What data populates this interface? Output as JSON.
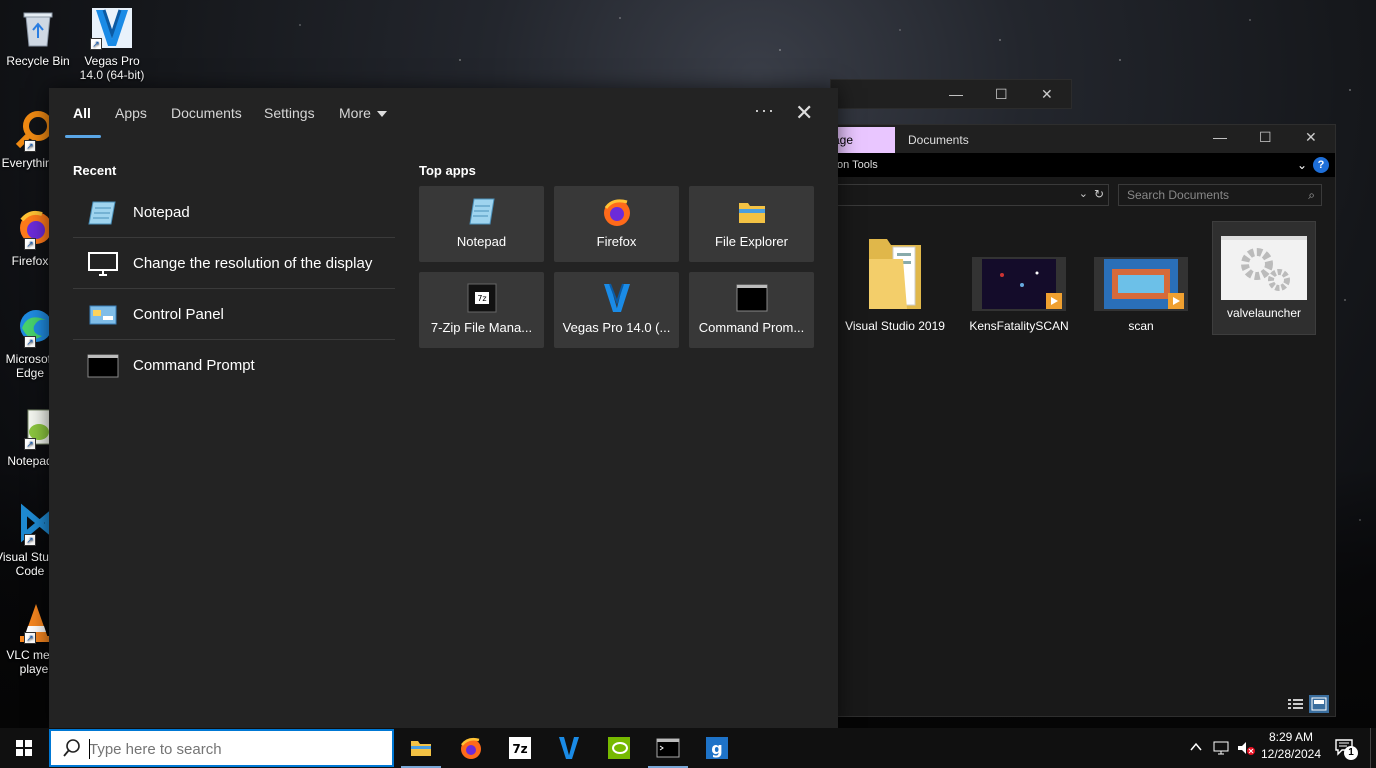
{
  "desktop": {
    "icons": [
      {
        "label": "Recycle Bin"
      },
      {
        "label": "Vegas Pro 14.0 (64-bit)"
      },
      {
        "label": "Everything"
      },
      {
        "label": "Firefox"
      },
      {
        "label": "Microsoft Edge"
      },
      {
        "label": "Notepad"
      },
      {
        "label": "Visual Studio Code"
      },
      {
        "label": "VLC media player"
      }
    ]
  },
  "explorer": {
    "tabs": {
      "manage": "age",
      "documents": "Documents"
    },
    "ribbon_text": "on Tools",
    "help_label": "?",
    "search_placeholder": "Search Documents",
    "files": [
      {
        "label": "Visual Studio 2019"
      },
      {
        "label": "KensFatalitySCAN"
      },
      {
        "label": "scan"
      },
      {
        "label": "valvelauncher"
      }
    ]
  },
  "search_panel": {
    "tabs": {
      "all": "All",
      "apps": "Apps",
      "documents": "Documents",
      "settings": "Settings",
      "more": "More"
    },
    "recent_heading": "Recent",
    "top_apps_heading": "Top apps",
    "recent": [
      {
        "label": "Notepad"
      },
      {
        "label": "Change the resolution of the display"
      },
      {
        "label": "Control Panel"
      },
      {
        "label": "Command Prompt"
      }
    ],
    "top_apps": [
      {
        "label": "Notepad"
      },
      {
        "label": "Firefox"
      },
      {
        "label": "File Explorer"
      },
      {
        "label": "7-Zip File Mana..."
      },
      {
        "label": "Vegas Pro 14.0 (..."
      },
      {
        "label": "Command Prom..."
      }
    ]
  },
  "taskbar": {
    "search_placeholder": "Type here to search",
    "clock_time": "8:29 AM",
    "clock_date": "12/28/2024",
    "notification_count": "1"
  }
}
